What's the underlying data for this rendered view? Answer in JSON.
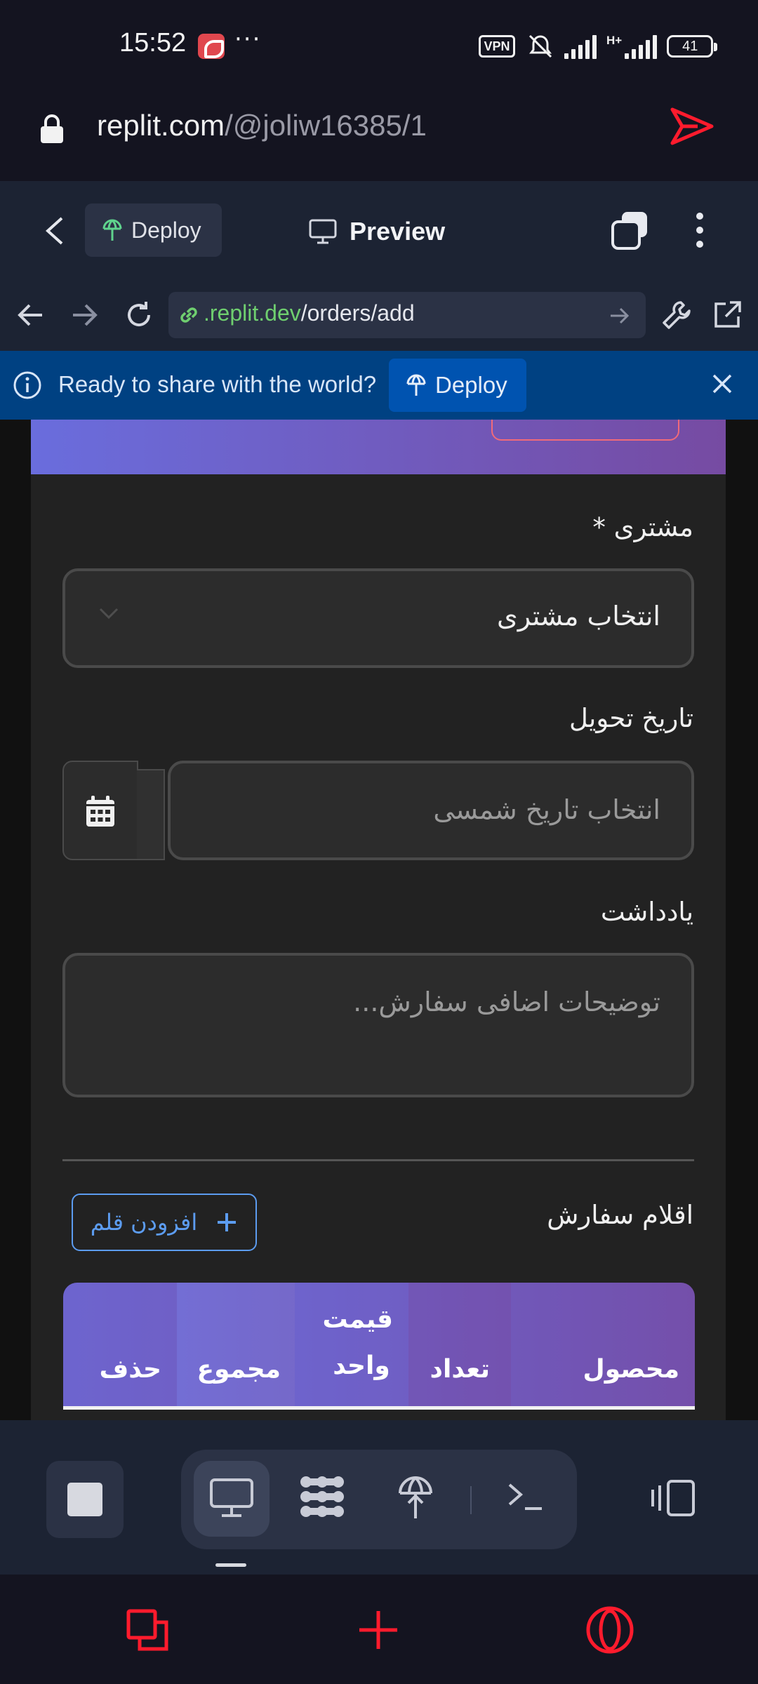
{
  "status_bar": {
    "time": "15:52",
    "more": "···",
    "vpn": "VPN",
    "battery": "41",
    "network": "H+"
  },
  "browser": {
    "url_domain": "replit.com",
    "url_path": "/@joliw16385/1"
  },
  "replit_header": {
    "deploy_label": "Deploy",
    "preview_label": "Preview"
  },
  "webview": {
    "url_domain": ".replit.dev",
    "url_path": "/orders/add"
  },
  "banner": {
    "message": "Ready to share with the world?",
    "deploy_label": "Deploy"
  },
  "form": {
    "customer_label": "مشتری *",
    "customer_placeholder": "انتخاب مشتری",
    "delivery_date_label": "تاریخ تحویل",
    "delivery_date_placeholder": "انتخاب تاریخ شمسی",
    "note_label": "یادداشت",
    "note_placeholder": "توضیحات اضافی سفارش...",
    "items_title": "اقلام سفارش",
    "add_item_label": "افزودن قلم"
  },
  "items_table": {
    "columns": [
      "محصول",
      "تعداد",
      "قیمت واحد",
      "مجموع",
      "حذف"
    ]
  },
  "colors": {
    "accent_gradient_start": "#6a6ddd",
    "accent_gradient_end": "#764ba2",
    "link_blue": "#5c9cf0",
    "banner_blue": "#004182",
    "opera_red": "#ff1b2d"
  }
}
